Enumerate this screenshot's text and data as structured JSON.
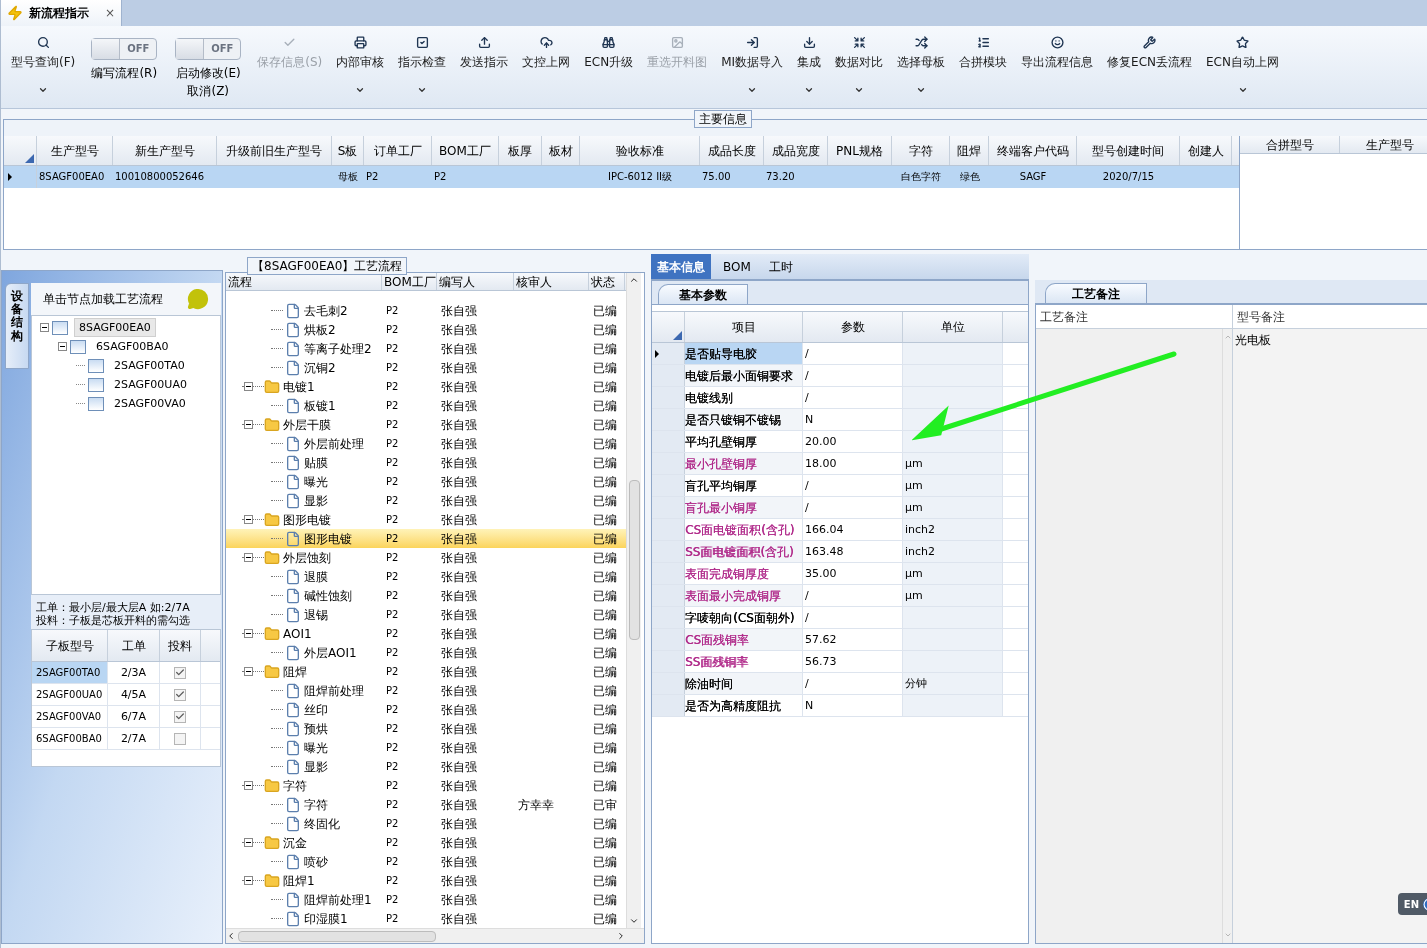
{
  "doc_tab": {
    "title": "新流程指示",
    "close": "×"
  },
  "toolbar": [
    {
      "kind": "button",
      "label": "型号查询(F)",
      "dropdown": true,
      "disabled": false
    },
    {
      "kind": "toggle",
      "label": "编写流程(R)",
      "switch_text": "OFF",
      "on": false
    },
    {
      "kind": "toggle",
      "label": "启动修改(E)",
      "label2": "取消(Z)",
      "switch_text": "OFF",
      "on": false
    },
    {
      "kind": "button",
      "label": "保存信息(S)",
      "dropdown": false,
      "disabled": true
    },
    {
      "kind": "button",
      "label": "内部审核",
      "dropdown": true,
      "disabled": false
    },
    {
      "kind": "button",
      "label": "指示检查",
      "dropdown": true,
      "disabled": false
    },
    {
      "kind": "button",
      "label": "发送指示",
      "dropdown": false,
      "disabled": false
    },
    {
      "kind": "button",
      "label": "文控上网",
      "dropdown": false,
      "disabled": false
    },
    {
      "kind": "button",
      "label": "ECN升级",
      "dropdown": false,
      "disabled": false
    },
    {
      "kind": "button",
      "label": "重选开料图",
      "dropdown": false,
      "disabled": true
    },
    {
      "kind": "button",
      "label": "MI数据导入",
      "dropdown": true,
      "disabled": false
    },
    {
      "kind": "button",
      "label": "集成",
      "dropdown": true,
      "disabled": false
    },
    {
      "kind": "button",
      "label": "数据对比",
      "dropdown": true,
      "disabled": false
    },
    {
      "kind": "button",
      "label": "选择母板",
      "dropdown": true,
      "disabled": false
    },
    {
      "kind": "button",
      "label": "合拼模块",
      "dropdown": false,
      "disabled": false
    },
    {
      "kind": "button",
      "label": "导出流程信息",
      "dropdown": false,
      "disabled": false
    },
    {
      "kind": "button",
      "label": "修复ECN丢流程",
      "dropdown": false,
      "disabled": false
    },
    {
      "kind": "button",
      "label": "ECN自动上网",
      "dropdown": true,
      "disabled": false
    }
  ],
  "main_info": {
    "title": "主要信息",
    "columns": [
      "生产型号",
      "新生产型号",
      "升级前旧生产型号",
      "S板",
      "订单工厂",
      "BOM工厂",
      "板厚",
      "板材",
      "验收标准",
      "成品长度",
      "成品宽度",
      "PNL规格",
      "字符",
      "阻焊",
      "终端客户代码",
      "型号创建时间",
      "创建人"
    ],
    "rows": [
      {
        "selected": true,
        "cells": [
          "8SAGF00EA0",
          "10010800052646",
          "",
          "母板",
          "P2",
          "P2",
          "",
          "",
          "IPC-6012 II级",
          "75.00",
          "73.20",
          "",
          "白色字符",
          "绿色",
          "SAGF",
          "2020/7/15",
          ""
        ]
      }
    ],
    "side_columns": [
      "合拼型号",
      "生产型号"
    ]
  },
  "structure_panel": {
    "side_tab": "设备结构",
    "hint": "单击节点加载工艺流程",
    "tree": [
      {
        "label": "8SAGF00EA0",
        "selected": true,
        "expanded": true,
        "children": [
          {
            "label": "6SAGF00BA0",
            "selected": false,
            "expanded": true,
            "children": [
              {
                "label": "2SAGF00TA0",
                "selected": false
              },
              {
                "label": "2SAGF00UA0",
                "selected": false
              },
              {
                "label": "2SAGF00VA0",
                "selected": false
              }
            ]
          }
        ]
      }
    ],
    "note_lines": [
      "工单：最小层/最大层A 如:2/7A",
      "投料：子板是芯板开料的需勾选"
    ],
    "sub_columns": [
      "子板型号",
      "工单",
      "投料"
    ],
    "sub_rows": [
      {
        "board": "2SAGF00TA0",
        "order": "2/3A",
        "checked": true,
        "selected": true
      },
      {
        "board": "2SAGF00UA0",
        "order": "4/5A",
        "checked": true,
        "selected": false
      },
      {
        "board": "2SAGF00VA0",
        "order": "6/7A",
        "checked": true,
        "selected": false
      },
      {
        "board": "6SAGF00BA0",
        "order": "2/7A",
        "checked": false,
        "selected": false
      }
    ]
  },
  "flow_panel": {
    "title": "【8SAGF00EA0】工艺流程",
    "columns": [
      "流程",
      "BOM工厂",
      "编写人",
      "核审人",
      "状态"
    ],
    "tree": [
      {
        "kind": "step",
        "name": "去毛刺2",
        "bom": "P2",
        "writer": "张自强",
        "status": "已编",
        "selected": false
      },
      {
        "kind": "step",
        "name": "烘板2",
        "bom": "P2",
        "writer": "张自强",
        "status": "已编",
        "selected": false
      },
      {
        "kind": "step",
        "name": "等离子处理2",
        "bom": "P2",
        "writer": "张自强",
        "status": "已编",
        "selected": false
      },
      {
        "kind": "step",
        "name": "沉铜2",
        "bom": "P2",
        "writer": "张自强",
        "status": "已编",
        "selected": false
      },
      {
        "kind": "folder",
        "name": "电镀1",
        "bom": "P2",
        "writer": "张自强",
        "status": "已编",
        "selected": false,
        "expanded": true,
        "children": [
          {
            "kind": "step",
            "name": "板镀1",
            "bom": "P2",
            "writer": "张自强",
            "status": "已编",
            "selected": false
          }
        ]
      },
      {
        "kind": "folder",
        "name": "外层干膜",
        "bom": "P2",
        "writer": "张自强",
        "status": "已编",
        "selected": false,
        "expanded": true,
        "children": [
          {
            "kind": "step",
            "name": "外层前处理",
            "bom": "P2",
            "writer": "张自强",
            "status": "已编",
            "selected": false
          },
          {
            "kind": "step",
            "name": "贴膜",
            "bom": "P2",
            "writer": "张自强",
            "status": "已编",
            "selected": false
          },
          {
            "kind": "step",
            "name": "曝光",
            "bom": "P2",
            "writer": "张自强",
            "status": "已编",
            "selected": false
          },
          {
            "kind": "step",
            "name": "显影",
            "bom": "P2",
            "writer": "张自强",
            "status": "已编",
            "selected": false
          }
        ]
      },
      {
        "kind": "folder",
        "name": "图形电镀",
        "bom": "P2",
        "writer": "张自强",
        "status": "已编",
        "selected": false,
        "expanded": true,
        "children": [
          {
            "kind": "step",
            "name": "图形电镀",
            "bom": "P2",
            "writer": "张自强",
            "status": "已编",
            "selected": true
          }
        ]
      },
      {
        "kind": "folder",
        "name": "外层蚀刻",
        "bom": "P2",
        "writer": "张自强",
        "status": "已编",
        "selected": false,
        "expanded": true,
        "children": [
          {
            "kind": "step",
            "name": "退膜",
            "bom": "P2",
            "writer": "张自强",
            "status": "已编",
            "selected": false
          },
          {
            "kind": "step",
            "name": "碱性蚀刻",
            "bom": "P2",
            "writer": "张自强",
            "status": "已编",
            "selected": false
          },
          {
            "kind": "step",
            "name": "退锡",
            "bom": "P2",
            "writer": "张自强",
            "status": "已编",
            "selected": false
          }
        ]
      },
      {
        "kind": "folder",
        "name": "AOI1",
        "bom": "P2",
        "writer": "张自强",
        "status": "已编",
        "selected": false,
        "expanded": true,
        "children": [
          {
            "kind": "step",
            "name": "外层AOI1",
            "bom": "P2",
            "writer": "张自强",
            "status": "已编",
            "selected": false
          }
        ]
      },
      {
        "kind": "folder",
        "name": "阻焊",
        "bom": "P2",
        "writer": "张自强",
        "status": "已编",
        "selected": false,
        "expanded": true,
        "children": [
          {
            "kind": "step",
            "name": "阻焊前处理",
            "bom": "P2",
            "writer": "张自强",
            "status": "已编",
            "selected": false
          },
          {
            "kind": "step",
            "name": "丝印",
            "bom": "P2",
            "writer": "张自强",
            "status": "已编",
            "selected": false
          },
          {
            "kind": "step",
            "name": "预烘",
            "bom": "P2",
            "writer": "张自强",
            "status": "已编",
            "selected": false
          },
          {
            "kind": "step",
            "name": "曝光",
            "bom": "P2",
            "writer": "张自强",
            "status": "已编",
            "selected": false
          },
          {
            "kind": "step",
            "name": "显影",
            "bom": "P2",
            "writer": "张自强",
            "status": "已编",
            "selected": false
          }
        ]
      },
      {
        "kind": "folder",
        "name": "字符",
        "bom": "P2",
        "writer": "张自强",
        "status": "已编",
        "selected": false,
        "expanded": true,
        "children": [
          {
            "kind": "step",
            "name": "字符",
            "bom": "P2",
            "writer": "张自强",
            "reviewer": "方幸幸",
            "status": "已审",
            "selected": false
          },
          {
            "kind": "step",
            "name": "终固化",
            "bom": "P2",
            "writer": "张自强",
            "status": "已编",
            "selected": false
          }
        ]
      },
      {
        "kind": "folder",
        "name": "沉金",
        "bom": "P2",
        "writer": "张自强",
        "status": "已编",
        "selected": false,
        "expanded": true,
        "children": [
          {
            "kind": "step",
            "name": "喷砂",
            "bom": "P2",
            "writer": "张自强",
            "status": "已编",
            "selected": false
          }
        ]
      },
      {
        "kind": "folder",
        "name": "阻焊1",
        "bom": "P2",
        "writer": "张自强",
        "status": "已编",
        "selected": false,
        "expanded": true,
        "children": [
          {
            "kind": "step",
            "name": "阻焊前处理1",
            "bom": "P2",
            "writer": "张自强",
            "status": "已编",
            "selected": false
          },
          {
            "kind": "step",
            "name": "印湿膜1",
            "bom": "P2",
            "writer": "张自强",
            "status": "已编",
            "selected": false
          }
        ]
      }
    ]
  },
  "detail_tabs": [
    {
      "label": "基本信息",
      "selected": true
    },
    {
      "label": "BOM",
      "selected": false
    },
    {
      "label": "工时",
      "selected": false
    }
  ],
  "params": {
    "tab": "基本参数",
    "columns": [
      "项目",
      "参数",
      "单位"
    ],
    "rows": [
      {
        "item": "是否贴导电胶",
        "value": "/",
        "unit": "",
        "color": "#000000",
        "selected": true
      },
      {
        "item": "电镀后最小面铜要求",
        "value": "/",
        "unit": "",
        "color": "#000000",
        "selected": false
      },
      {
        "item": "电镀线别",
        "value": "/",
        "unit": "",
        "color": "#000000",
        "selected": false
      },
      {
        "item": "是否只镀铜不镀锡",
        "value": "N",
        "unit": "",
        "color": "#000000",
        "selected": false
      },
      {
        "item": "平均孔壁铜厚",
        "value": "20.00",
        "unit": "",
        "color": "#000000",
        "selected": false
      },
      {
        "item": "最小孔壁铜厚",
        "value": "18.00",
        "unit": "μm",
        "color": "#b02a8a",
        "selected": false
      },
      {
        "item": "盲孔平均铜厚",
        "value": "/",
        "unit": "μm",
        "color": "#000000",
        "selected": false
      },
      {
        "item": "盲孔最小铜厚",
        "value": "/",
        "unit": "μm",
        "color": "#b02a8a",
        "selected": false
      },
      {
        "item": "CS面电镀面积(含孔)",
        "value": "166.04",
        "unit": "inch2",
        "color": "#b02a8a",
        "selected": false
      },
      {
        "item": "SS面电镀面积(含孔)",
        "value": "163.48",
        "unit": "inch2",
        "color": "#b02a8a",
        "selected": false
      },
      {
        "item": "表面完成铜厚度",
        "value": "35.00",
        "unit": "μm",
        "color": "#b02a8a",
        "selected": false
      },
      {
        "item": "表面最小完成铜厚",
        "value": "/",
        "unit": "μm",
        "color": "#b02a8a",
        "selected": false
      },
      {
        "item": "字唛朝向(CS面朝外)",
        "value": "/",
        "unit": "",
        "color": "#000000",
        "selected": false
      },
      {
        "item": "CS面残铜率",
        "value": "57.62",
        "unit": "",
        "color": "#b02a8a",
        "selected": false
      },
      {
        "item": "SS面残铜率",
        "value": "56.73",
        "unit": "",
        "color": "#b02a8a",
        "selected": false
      },
      {
        "item": "除油时间",
        "value": "/",
        "unit": "分钟",
        "color": "#000000",
        "selected": false
      },
      {
        "item": "是否为高精度阻抗",
        "value": "N",
        "unit": "",
        "color": "#000000",
        "selected": false
      }
    ]
  },
  "notes": {
    "tab": "工艺备注",
    "columns": [
      "工艺备注",
      "型号备注"
    ],
    "model_note": "光电板"
  },
  "language_bar": {
    "label": "EN"
  }
}
